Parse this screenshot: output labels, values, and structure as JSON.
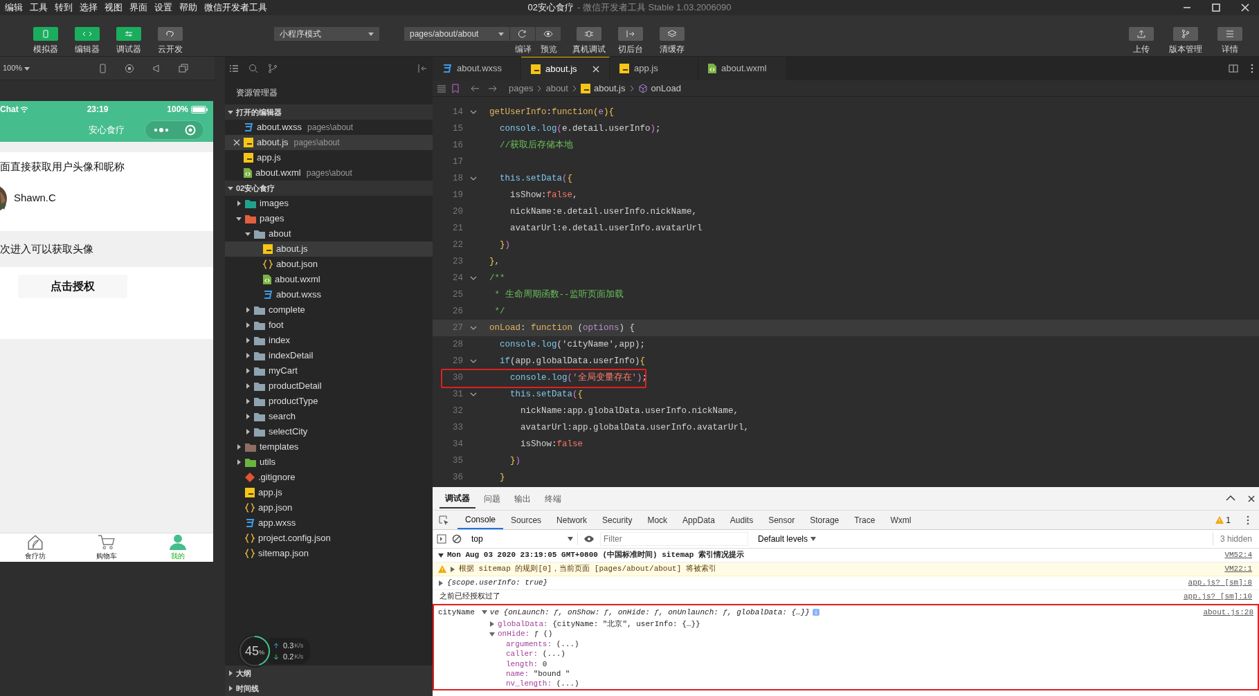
{
  "window": {
    "title": "02安心食疗",
    "subtitle": "- 微信开发者工具 Stable 1.03.2006090"
  },
  "menu": [
    "编辑",
    "工具",
    "转到",
    "选择",
    "视图",
    "界面",
    "设置",
    "帮助",
    "微信开发者工具"
  ],
  "toolbar": {
    "modes": [
      {
        "label": "模拟器",
        "on": true
      },
      {
        "label": "编辑器",
        "on": true
      },
      {
        "label": "调试器",
        "on": true
      },
      {
        "label": "云开发",
        "on": false
      }
    ],
    "compile_mode": "小程序模式",
    "page_path": "pages/about/about",
    "path_actions": [
      "编译",
      "预览"
    ],
    "actions": [
      "真机调试",
      "切后台",
      "清缓存"
    ],
    "right_actions": [
      "上传",
      "版本管理",
      "详情"
    ]
  },
  "simulator": {
    "zoom": "100%",
    "phone": {
      "carrier": "Chat",
      "time": "23:19",
      "battery": "100%",
      "nav_title": "安心食疗",
      "intro_text": "面直接获取用户头像和昵称",
      "nickname": "Shawn.C",
      "notice_text": "次进入可以获取头像",
      "auth_button": "点击授权",
      "tabbar": [
        {
          "label": "食疗坊",
          "selected": false
        },
        {
          "label": "购物车",
          "selected": false
        },
        {
          "label": "我的",
          "selected": true
        }
      ]
    }
  },
  "explorer": {
    "title": "资源管理器",
    "open_editors": {
      "title": "打开的编辑器",
      "expanded": true,
      "items": [
        {
          "name": "about.wxss",
          "kind": "wxss",
          "path": "pages\\about",
          "selected": false
        },
        {
          "name": "about.js",
          "kind": "js",
          "path": "pages\\about",
          "selected": true
        },
        {
          "name": "app.js",
          "kind": "js",
          "selected": false
        },
        {
          "name": "about.wxml",
          "kind": "wxml",
          "path": "pages\\about",
          "selected": false
        }
      ]
    },
    "project": {
      "title": "02安心食疗",
      "expanded": true,
      "children": [
        {
          "name": "images",
          "kind": "folder",
          "color": "#1fa38f",
          "expanded": false,
          "selected": false
        },
        {
          "name": "pages",
          "kind": "folder",
          "color": "#e2603f",
          "expanded": true,
          "selected": false,
          "children": [
            {
              "name": "about",
              "kind": "folder",
              "color": "#8fa3b0",
              "expanded": true,
              "selected": false,
              "children": [
                {
                  "name": "about.js",
                  "kind": "js",
                  "selected": true
                },
                {
                  "name": "about.json",
                  "kind": "json",
                  "selected": false
                },
                {
                  "name": "about.wxml",
                  "kind": "wxml",
                  "selected": false
                },
                {
                  "name": "about.wxss",
                  "kind": "wxss",
                  "selected": false
                }
              ]
            },
            {
              "name": "complete",
              "kind": "folder",
              "color": "#8fa3b0",
              "expanded": false,
              "selected": false
            },
            {
              "name": "foot",
              "kind": "folder",
              "color": "#8fa3b0",
              "expanded": false,
              "selected": false
            },
            {
              "name": "index",
              "kind": "folder",
              "color": "#8fa3b0",
              "expanded": false,
              "selected": false
            },
            {
              "name": "indexDetail",
              "kind": "folder",
              "color": "#8fa3b0",
              "expanded": false,
              "selected": false
            },
            {
              "name": "myCart",
              "kind": "folder",
              "color": "#8fa3b0",
              "expanded": false,
              "selected": false
            },
            {
              "name": "productDetail",
              "kind": "folder",
              "color": "#8fa3b0",
              "expanded": false,
              "selected": false
            },
            {
              "name": "productType",
              "kind": "folder",
              "color": "#8fa3b0",
              "expanded": false,
              "selected": false
            },
            {
              "name": "search",
              "kind": "folder",
              "color": "#8fa3b0",
              "expanded": false,
              "selected": false
            },
            {
              "name": "selectCity",
              "kind": "folder",
              "color": "#8fa3b0",
              "expanded": false,
              "selected": false
            }
          ]
        },
        {
          "name": "templates",
          "kind": "folder",
          "color": "#8d6e63",
          "expanded": false,
          "selected": false
        },
        {
          "name": "utils",
          "kind": "folder",
          "color": "#6cb33f",
          "expanded": false,
          "selected": false
        },
        {
          "name": ".gitignore",
          "kind": "git",
          "selected": false
        },
        {
          "name": "app.js",
          "kind": "js",
          "selected": false
        },
        {
          "name": "app.json",
          "kind": "json",
          "selected": false
        },
        {
          "name": "app.wxss",
          "kind": "wxss",
          "selected": false
        },
        {
          "name": "project.config.json",
          "kind": "json",
          "selected": false
        },
        {
          "name": "sitemap.json",
          "kind": "json",
          "selected": false
        }
      ]
    },
    "outline": "大纲",
    "timeline": "时间线"
  },
  "net_monitor": {
    "percent": "45",
    "percent_sign": "%",
    "up": "0.3",
    "up_unit": "K/s",
    "down": "0.2",
    "down_unit": "K/s"
  },
  "editor": {
    "tabs": [
      {
        "name": "about.wxss",
        "kind": "wxss",
        "selected": false
      },
      {
        "name": "about.js",
        "kind": "js",
        "selected": true
      },
      {
        "name": "app.js",
        "kind": "js",
        "selected": false
      },
      {
        "name": "about.wxml",
        "kind": "wxml",
        "selected": false
      }
    ],
    "breadcrumb": [
      {
        "text": "pages",
        "kind": "dir"
      },
      {
        "text": "about",
        "kind": "dir"
      },
      {
        "text": "about.js",
        "kind": "js"
      },
      {
        "text": "onLoad",
        "kind": "method"
      }
    ],
    "code": [
      {
        "n": "14",
        "fold": true,
        "current": false,
        "boxed": false,
        "tokens": [
          {
            "text": "getUserInfo",
            "kind": "kw"
          },
          {
            "text": ":",
            "kind": "txt"
          },
          {
            "text": "function",
            "kind": "kw"
          },
          {
            "text": "(",
            "kind": "br1"
          },
          {
            "text": "e",
            "kind": "par"
          },
          {
            "text": "){",
            "kind": "br1"
          }
        ]
      },
      {
        "n": "15",
        "fold": false,
        "current": false,
        "boxed": false,
        "tokens": [
          {
            "text": "  console.log",
            "kind": "fn"
          },
          {
            "text": "(",
            "kind": "br2"
          },
          {
            "text": "e.detail.userInfo",
            "kind": "txt"
          },
          {
            "text": ")",
            "kind": "br2"
          },
          {
            "text": ";",
            "kind": "txt"
          }
        ]
      },
      {
        "n": "16",
        "fold": false,
        "current": false,
        "boxed": false,
        "tokens": [
          {
            "text": "  //获取后存储本地",
            "kind": "cmt"
          }
        ]
      },
      {
        "n": "17",
        "fold": false,
        "current": false,
        "boxed": false
      },
      {
        "n": "18",
        "fold": true,
        "current": false,
        "boxed": false,
        "tokens": [
          {
            "text": "  this.setData",
            "kind": "fn"
          },
          {
            "text": "(",
            "kind": "br2"
          },
          {
            "text": "{",
            "kind": "br1"
          }
        ]
      },
      {
        "n": "19",
        "fold": false,
        "current": false,
        "boxed": false,
        "tokens": [
          {
            "text": "    isShow:",
            "kind": "txt"
          },
          {
            "text": "false",
            "kind": "bool"
          },
          {
            "text": ",",
            "kind": "txt"
          }
        ]
      },
      {
        "n": "20",
        "fold": false,
        "current": false,
        "boxed": false,
        "tokens": [
          {
            "text": "    nickName:e.detail.userInfo.nickName,",
            "kind": "txt"
          }
        ]
      },
      {
        "n": "21",
        "fold": false,
        "current": false,
        "boxed": false,
        "tokens": [
          {
            "text": "    avatarUrl:e.detail.userInfo.avatarUrl",
            "kind": "txt"
          }
        ]
      },
      {
        "n": "22",
        "fold": false,
        "current": false,
        "boxed": false,
        "tokens": [
          {
            "text": "  }",
            "kind": "br1"
          },
          {
            "text": ")",
            "kind": "br2"
          }
        ]
      },
      {
        "n": "23",
        "fold": false,
        "current": false,
        "boxed": false,
        "tokens": [
          {
            "text": "}",
            "kind": "br1"
          },
          {
            "text": ",",
            "kind": "txt"
          }
        ]
      },
      {
        "n": "24",
        "fold": true,
        "current": false,
        "boxed": false,
        "tokens": [
          {
            "text": "/**",
            "kind": "cmt"
          }
        ]
      },
      {
        "n": "25",
        "fold": false,
        "current": false,
        "boxed": false,
        "tokens": [
          {
            "text": " * 生命周期函数--监听页面加载",
            "kind": "cmt"
          }
        ]
      },
      {
        "n": "26",
        "fold": false,
        "current": false,
        "boxed": false,
        "tokens": [
          {
            "text": " */",
            "kind": "cmt"
          }
        ]
      },
      {
        "n": "27",
        "fold": true,
        "current": true,
        "boxed": false,
        "tokens": [
          {
            "text": "onLoad",
            "kind": "kw"
          },
          {
            "text": ": ",
            "kind": "txt"
          },
          {
            "text": "function",
            "kind": "kw"
          },
          {
            "text": " (",
            "kind": "txt"
          },
          {
            "text": "options",
            "kind": "par"
          },
          {
            "text": ") {",
            "kind": "txt"
          }
        ]
      },
      {
        "n": "28",
        "fold": false,
        "current": false,
        "boxed": false,
        "tokens": [
          {
            "text": "  console.log",
            "kind": "fn"
          },
          {
            "text": "('cityName',app);",
            "kind": "txt"
          }
        ]
      },
      {
        "n": "29",
        "fold": true,
        "current": false,
        "boxed": false,
        "tokens": [
          {
            "text": "  if",
            "kind": "fn"
          },
          {
            "text": "(app.globalData.userInfo)",
            "kind": "txt"
          },
          {
            "text": "{",
            "kind": "br1"
          }
        ]
      },
      {
        "n": "30",
        "fold": false,
        "current": false,
        "boxed": true,
        "tokens": [
          {
            "text": "    console.log",
            "kind": "fn"
          },
          {
            "text": "(",
            "kind": "br2"
          },
          {
            "text": "'全局变量存在'",
            "kind": "str"
          },
          {
            "text": ")",
            "kind": "br2"
          },
          {
            "text": ";",
            "kind": "txt"
          }
        ]
      },
      {
        "n": "31",
        "fold": true,
        "current": false,
        "boxed": false,
        "tokens": [
          {
            "text": "    this.setData",
            "kind": "fn"
          },
          {
            "text": "(",
            "kind": "br2"
          },
          {
            "text": "{",
            "kind": "br1"
          }
        ]
      },
      {
        "n": "32",
        "fold": false,
        "current": false,
        "boxed": false,
        "tokens": [
          {
            "text": "      nickName:app.globalData.userInfo.nickName,",
            "kind": "txt"
          }
        ]
      },
      {
        "n": "33",
        "fold": false,
        "current": false,
        "boxed": false,
        "tokens": [
          {
            "text": "      avatarUrl:app.globalData.userInfo.avatarUrl,",
            "kind": "txt"
          }
        ]
      },
      {
        "n": "34",
        "fold": false,
        "current": false,
        "boxed": false,
        "tokens": [
          {
            "text": "      isShow:",
            "kind": "txt"
          },
          {
            "text": "false",
            "kind": "bool"
          }
        ]
      },
      {
        "n": "35",
        "fold": false,
        "current": false,
        "boxed": false,
        "tokens": [
          {
            "text": "    }",
            "kind": "br1"
          },
          {
            "text": ")",
            "kind": "br2"
          }
        ]
      },
      {
        "n": "36",
        "fold": false,
        "current": false,
        "boxed": false,
        "tokens": [
          {
            "text": "  }",
            "kind": "br1"
          }
        ]
      }
    ]
  },
  "console": {
    "panel_tabs": [
      {
        "label": "调试器",
        "selected": true
      },
      {
        "label": "问题",
        "selected": false
      },
      {
        "label": "输出",
        "selected": false
      },
      {
        "label": "终端",
        "selected": false
      }
    ],
    "devtools_tabs": [
      {
        "label": "Console",
        "selected": true
      },
      {
        "label": "Sources",
        "selected": false
      },
      {
        "label": "Network",
        "selected": false
      },
      {
        "label": "Security",
        "selected": false
      },
      {
        "label": "Mock",
        "selected": false
      },
      {
        "label": "AppData",
        "selected": false
      },
      {
        "label": "Audits",
        "selected": false
      },
      {
        "label": "Sensor",
        "selected": false
      },
      {
        "label": "Storage",
        "selected": false
      },
      {
        "label": "Trace",
        "selected": false
      },
      {
        "label": "Wxml",
        "selected": false
      }
    ],
    "warning_count": "1",
    "context": "top",
    "filter_placeholder": "Filter",
    "levels": "Default levels",
    "hidden": "3 hidden",
    "messages": [
      {
        "kind": "group",
        "text": "Mon Aug 03 2020 23:19:05 GMT+0800 (中国标准时间) sitemap 索引情况提示",
        "source": "VM52:4",
        "expanded": true,
        "boxed": false
      },
      {
        "kind": "warning",
        "text": "根据 sitemap 的规则[0]，当前页面 [pages/about/about] 将被索引",
        "source": "VM22:1",
        "expanded": false,
        "boxed": false
      },
      {
        "kind": "object",
        "text": "{scope.userInfo: true}",
        "source": "app.js? [sm]:8",
        "expanded": false,
        "boxed": false
      },
      {
        "kind": "log",
        "text": "之前已经授权过了",
        "source": "app.js? [sm]:10",
        "boxed": false
      },
      {
        "kind": "object",
        "label": "cityName",
        "text": "ve {onLaunch: ƒ, onShow: ƒ, onHide: ƒ, onUnlaunch: ƒ, globalData: {…}}",
        "source": "about.js:28",
        "expanded": true,
        "boxed": true,
        "children": [
          {
            "key": "globalData:",
            "value": "{cityName: \"北京\", userInfo: {…}}",
            "expanded": false
          },
          {
            "key": "onHide:",
            "value": "ƒ ()",
            "expanded": true,
            "children": [
              {
                "key": "arguments:",
                "value": "(...)"
              },
              {
                "key": "caller:",
                "value": "(...)"
              },
              {
                "key": "length:",
                "value": "0"
              },
              {
                "key": "name:",
                "value": "\"bound \""
              },
              {
                "key": "nv_length:",
                "value": "(...)"
              }
            ]
          }
        ]
      }
    ]
  }
}
